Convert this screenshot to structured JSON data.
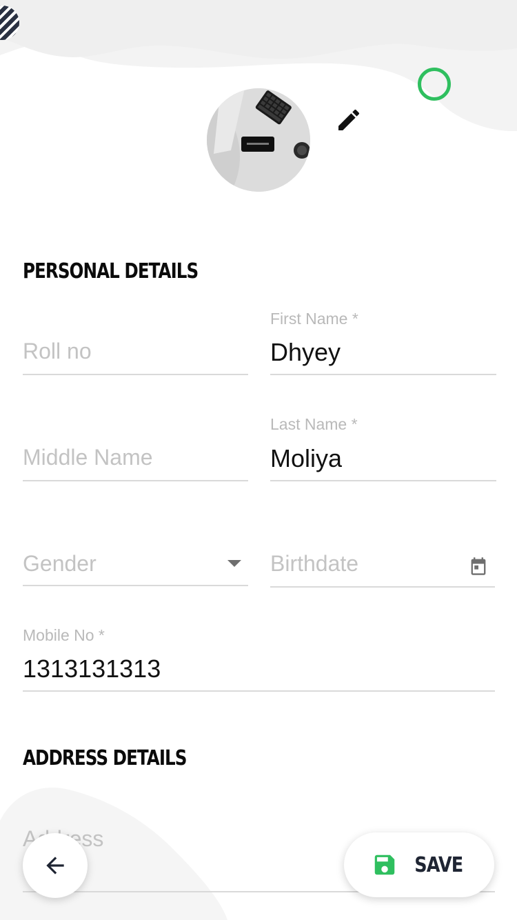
{
  "sections": {
    "personal": "PERSONAL DETAILS",
    "address": "ADDRESS DETAILS"
  },
  "fields": {
    "roll_no": {
      "placeholder": "Roll no"
    },
    "first_name": {
      "label": "First Name *",
      "value": "Dhyey"
    },
    "middle_name": {
      "placeholder": "Middle Name"
    },
    "last_name": {
      "label": "Last Name *",
      "value": "Moliya"
    },
    "gender": {
      "placeholder": "Gender"
    },
    "birthdate": {
      "placeholder": "Birthdate"
    },
    "mobile_no": {
      "label": "Mobile No *",
      "value": "1313131313"
    },
    "address": {
      "placeholder": "Address"
    }
  },
  "buttons": {
    "save": "SAVE"
  },
  "icons": {
    "edit": "pencil-icon",
    "back": "arrow-left-icon",
    "save": "floppy-disk-icon",
    "calendar": "calendar-icon",
    "dropdown": "caret-down-icon"
  },
  "colors": {
    "accent_green": "#2fbf5f",
    "dark": "#1f2533",
    "placeholder": "#c3c3c3",
    "underline": "#d9d9d9"
  }
}
